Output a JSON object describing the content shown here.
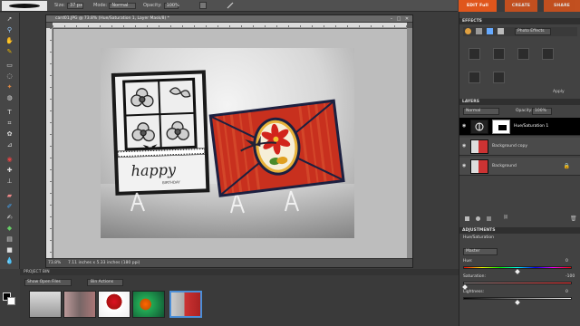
{
  "options_bar": {
    "size_label": "Size:",
    "size_value": "37 px",
    "mode_label": "Mode:",
    "mode_value": "Normal",
    "opacity_label": "Opacity:",
    "opacity_value": "100%"
  },
  "mode_buttons": {
    "edit": "EDIT Full",
    "create": "CREATE",
    "share": "SHARE"
  },
  "document": {
    "title": "card01.JPG @ 73.8% (Hue/Saturation 1, Layer Mask/8) *",
    "zoom": "73.8%",
    "info": "7.11 inches x 5.33 inches (180 ppi)"
  },
  "project_bin": {
    "header": "PROJECT BIN",
    "show_select": "Show Open Files",
    "actions": "Bin Actions",
    "thumbnails": [
      "portrait",
      "friends",
      "cardinal",
      "flower-butterfly",
      "card"
    ]
  },
  "effects_panel": {
    "title": "EFFECTS",
    "category": "Photo Effects",
    "apply": "Apply"
  },
  "layers_panel": {
    "title": "LAYERS",
    "blend_mode": "Normal",
    "opacity_label": "Opacity:",
    "opacity_value": "100%",
    "layers": [
      {
        "name": "Hue/Saturation 1",
        "selected": true
      },
      {
        "name": "Background copy",
        "selected": false
      },
      {
        "name": "Background",
        "selected": false
      }
    ]
  },
  "adjustments_panel": {
    "title": "ADJUSTMENTS",
    "subtitle": "Hue/Saturation",
    "channel": "Master",
    "hue_label": "Hue:",
    "hue_value": "0",
    "saturation_label": "Saturation:",
    "saturation_value": "-100",
    "saturation_level": 0.0,
    "lightness_label": "Lightness:",
    "lightness_value": "0"
  },
  "colors": {
    "accent_orange": "#e0561c",
    "selected_layer": "#000000",
    "card_red": "#c8301e"
  }
}
